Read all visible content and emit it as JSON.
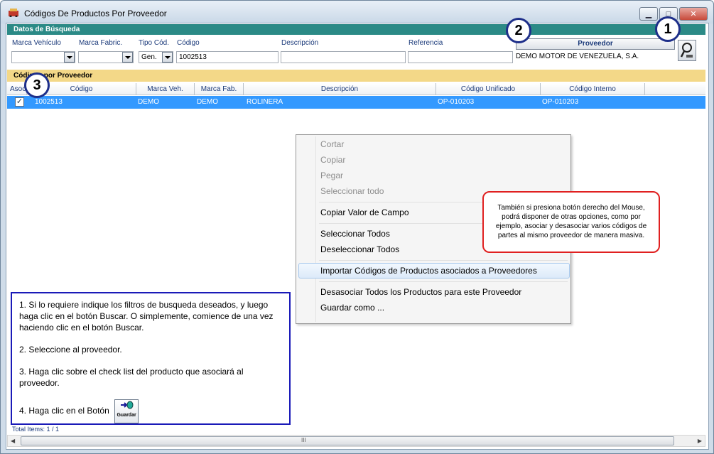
{
  "window": {
    "title": "Códigos De Productos Por Proveedor"
  },
  "search": {
    "band_label": "Datos de Búsqueda",
    "labels": {
      "marca_vehiculo": "Marca Vehículo",
      "marca_fabric": "Marca Fabric.",
      "tipo_cod": "Tipo Cód.",
      "codigo": "Código",
      "descripcion": "Descripción",
      "referencia": "Referencia"
    },
    "tipo_cod_value": "Gen.",
    "codigo_value": "1002513",
    "proveedor_button": "Proveedor",
    "proveedor_name": "DEMO MOTOR DE VENEZUELA, S.A."
  },
  "grid": {
    "band_label": "Códigos por Proveedor",
    "columns": [
      "Asoc.",
      "Código",
      "Marca Veh.",
      "Marca Fab.",
      "Descripción",
      "Código Unificado",
      "Código Interno"
    ],
    "rows": [
      {
        "checked": true,
        "codigo": "1002513",
        "marca_veh": "DEMO",
        "marca_fab": "DEMO",
        "descripcion": "ROLINERA",
        "codigo_unificado": "OP-010203",
        "codigo_interno": "OP-010203"
      }
    ]
  },
  "context_menu": {
    "items": [
      "Cortar",
      "Copiar",
      "Pegar",
      "Seleccionar todo",
      "Copiar Valor de Campo",
      "Seleccionar Todos",
      "Deseleccionar Todos",
      "Importar Códigos de Productos asociados a Proveedores",
      "Desasociar Todos los Productos para este Proveedor",
      "Guardar como ..."
    ]
  },
  "notes": {
    "red": "También si presiona botón derecho del Mouse, podrá disponer de otras opciones, como por ejemplo, asociar y desasociar varios códigos de partes al mismo proveedor de manera masiva.",
    "blue": [
      "1. Si lo requiere indique los filtros de busqueda deseados, y luego haga clic en el botón Buscar. O simplemente, comience de una vez haciendo clic en el botón Buscar.",
      "2. Seleccione al proveedor.",
      "3. Haga clic sobre el check list del producto que asociará al proveedor.",
      "4. Haga clic en el Botón"
    ],
    "guardar_label": "Guardar"
  },
  "badges": [
    "1",
    "2",
    "3"
  ],
  "status": {
    "total_items": "Total Items: 1 / 1"
  },
  "scrollbar": {
    "grip": "III"
  }
}
